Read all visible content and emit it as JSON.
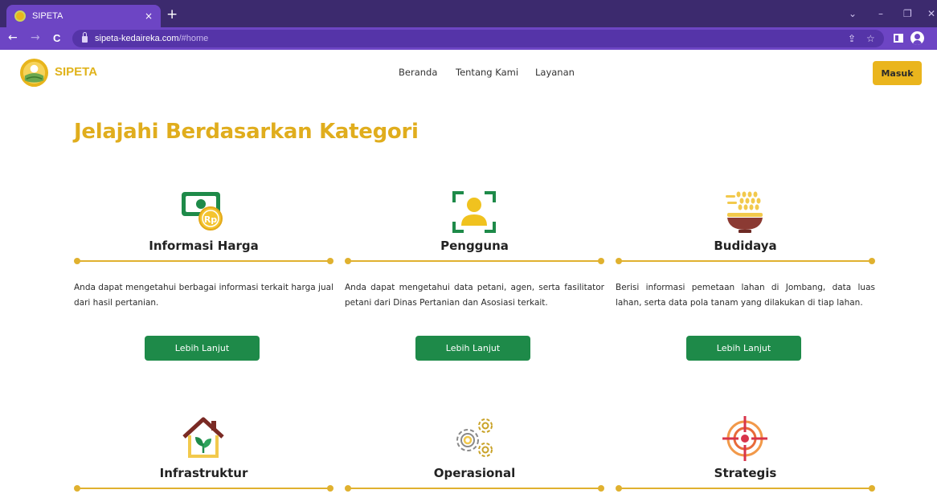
{
  "browser": {
    "tab_title": "SIPETA",
    "tab_close": "×",
    "new_tab": "+",
    "url_host": "sipeta-kedaireka.com",
    "url_path": "/#home",
    "controls": {
      "back": "←",
      "forward": "→",
      "reload": "C",
      "chevron": "⌄",
      "minimize": "–",
      "restore": "❐",
      "close": "✕"
    },
    "omnibox_icons": {
      "share": "⇪",
      "bookmark": "☆"
    }
  },
  "header": {
    "brand": "SIPETA",
    "nav": [
      "Beranda",
      "Tentang Kami",
      "Layanan"
    ],
    "login_button": "Masuk"
  },
  "main": {
    "title": "Jelajahi Berdasarkan Kategori",
    "cards": [
      {
        "icon": "money-icon",
        "title": "Informasi Harga",
        "text": "Anda dapat mengetahui berbagai informasi terkait harga jual dari hasil pertanian.",
        "button": "Lebih Lanjut"
      },
      {
        "icon": "user-icon",
        "title": "Pengguna",
        "text": "Anda dapat mengetahui data petani, agen, serta fasilitator petani dari Dinas Pertanian dan Asosiasi terkait.",
        "button": "Lebih Lanjut"
      },
      {
        "icon": "grain-bowl-icon",
        "title": "Budidaya",
        "text": "Berisi informasi pemetaan lahan di Jombang, data luas lahan, serta data pola tanam yang dilakukan di tiap lahan.",
        "button": "Lebih Lanjut"
      },
      {
        "icon": "house-icon",
        "title": "Infrastruktur"
      },
      {
        "icon": "gears-icon",
        "title": "Operasional"
      },
      {
        "icon": "target-icon",
        "title": "Strategis"
      }
    ]
  },
  "colors": {
    "accent": "#e0ad1d",
    "button_green": "#1e8a49",
    "chrome_purple": "#6d45c4"
  }
}
